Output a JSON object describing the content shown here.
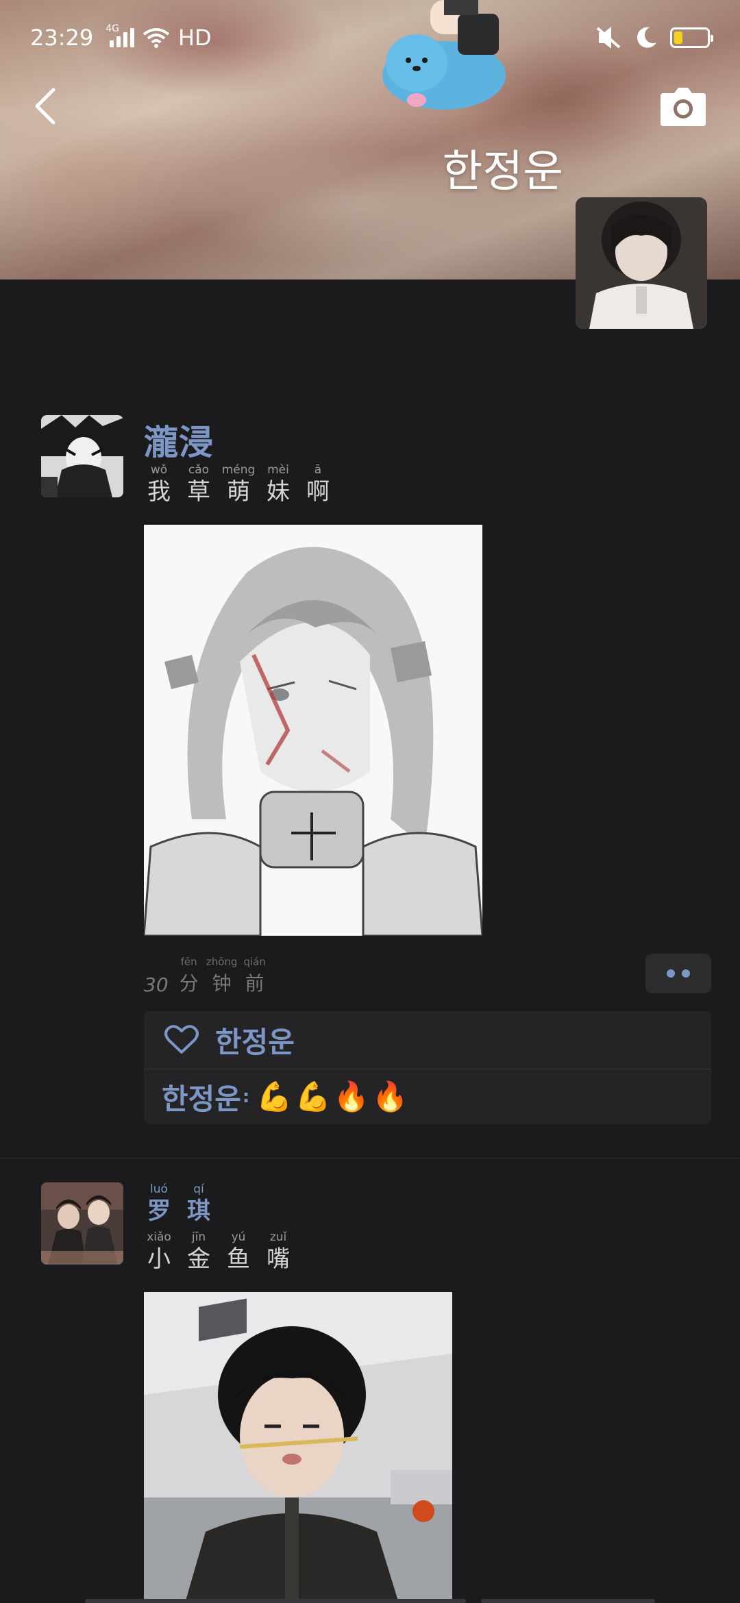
{
  "status_bar": {
    "time": "23:29",
    "network": "4G",
    "hd": "HD",
    "battery_level": 0.25,
    "icons": [
      "signal-icon",
      "wifi-icon",
      "mute-icon",
      "moon-icon",
      "battery-icon"
    ]
  },
  "profile": {
    "name": "한정운"
  },
  "colors": {
    "accent": "#7c96c6",
    "background": "#1b1b1d",
    "panel": "#242427"
  },
  "posts": [
    {
      "author": "瀧浸",
      "content_chars": [
        {
          "py": "wǒ",
          "hz": "我"
        },
        {
          "py": "cǎo",
          "hz": "草"
        },
        {
          "py": "méng",
          "hz": "萌"
        },
        {
          "py": "mèi",
          "hz": "妹"
        },
        {
          "py": "ā",
          "hz": "啊"
        }
      ],
      "time_num": "30",
      "time_chars": [
        {
          "py": "fēn",
          "hz": "分"
        },
        {
          "py": "zhōng",
          "hz": "钟"
        },
        {
          "py": "qián",
          "hz": "前"
        }
      ],
      "likes": [
        "한정운"
      ],
      "comments": [
        {
          "user": "한정운",
          "sep": ":",
          "text": "💪💪🔥🔥"
        }
      ]
    },
    {
      "author_chars": [
        {
          "py": "luó",
          "hz": "罗"
        },
        {
          "py": "qí",
          "hz": "琪"
        }
      ],
      "content_chars": [
        {
          "py": "xiǎo",
          "hz": "小"
        },
        {
          "py": "jīn",
          "hz": "金"
        },
        {
          "py": "yú",
          "hz": "鱼"
        },
        {
          "py": "zuǐ",
          "hz": "嘴"
        }
      ]
    }
  ]
}
